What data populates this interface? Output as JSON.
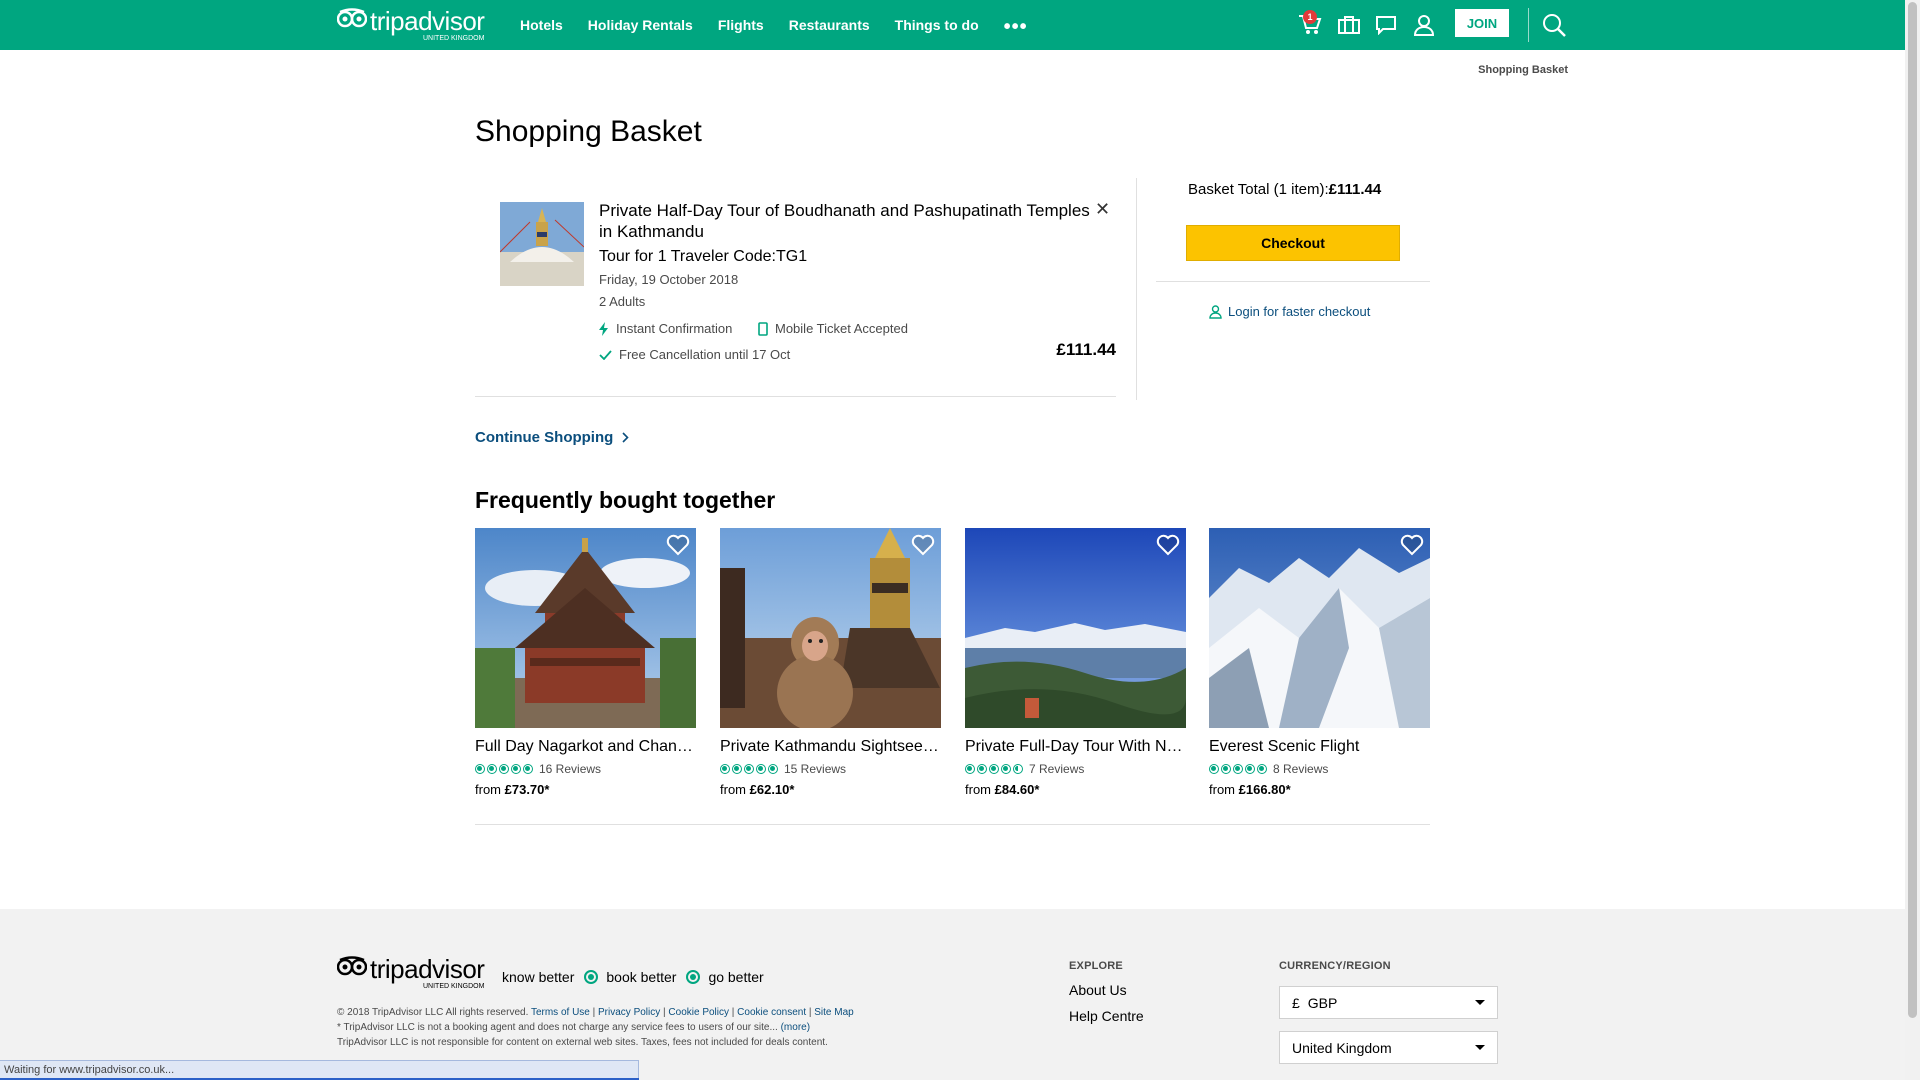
{
  "header": {
    "logo": {
      "word": "tripadvisor",
      "sub": "UNITED KINGDOM"
    },
    "nav": [
      "Hotels",
      "Holiday Rentals",
      "Flights",
      "Restaurants",
      "Things to do"
    ],
    "more": "•••",
    "icons": [
      "cart-icon",
      "trips-icon",
      "messages-icon",
      "profile-icon",
      "search-icon"
    ],
    "cart_count": "1",
    "join_label": "JOIN"
  },
  "breadcrumb": "Shopping Basket",
  "page_title": "Shopping Basket",
  "basket_item": {
    "title": "Private Half-Day Tour of Boudhanath and Pashupatinath Temples in Kathmandu",
    "subtitle": "Tour for 1 Traveler Code:TG1",
    "date": "Friday, 19 October 2018",
    "travelers": "2 Adults",
    "features": {
      "instant": "Instant Confirmation",
      "mobile": "Mobile Ticket Accepted",
      "cancellation": "Free Cancellation until 17 Oct"
    },
    "price": "£111.44",
    "remove": "✕"
  },
  "summary": {
    "total_label": "Basket Total (1 item):",
    "total_value": "£111.44",
    "checkout_label": "Checkout",
    "login_label": "Login for faster checkout"
  },
  "continue_label": "Continue Shopping",
  "fbt": {
    "title": "Frequently bought together",
    "cards": [
      {
        "title": "Full Day Nagarkot and Changu Narayan Tour",
        "rating": 5,
        "reviews": "16 Reviews",
        "from": "from ",
        "price": "£73.70*"
      },
      {
        "title": "Private Kathmandu Sightseeing Tour",
        "rating": 5,
        "reviews": "15 Reviews",
        "from": "from ",
        "price": "£62.10*"
      },
      {
        "title": "Private Full-Day Tour With Nagarkot Sunrise",
        "rating": 4.5,
        "reviews": "7 Reviews",
        "from": "from ",
        "price": "£84.60*"
      },
      {
        "title": "Everest Scenic Flight",
        "rating": 5,
        "reviews": "8 Reviews",
        "from": "from ",
        "price": "£166.80*"
      }
    ]
  },
  "footer": {
    "tagline": [
      "know better",
      "book better",
      "go better"
    ],
    "legal": {
      "copyright": "© 2018 TripAdvisor LLC All rights reserved.",
      "links": [
        "Terms of Use",
        "Privacy Policy",
        "Cookie Policy",
        "Cookie consent",
        "Site Map"
      ],
      "line2": "* TripAdvisor LLC is not a booking agent and does not charge any service fees to users of our site...",
      "more": "(more)",
      "line3": "TripAdvisor LLC is not responsible for content on external web sites. Taxes, fees not included for deals content."
    },
    "explore": {
      "heading": "EXPLORE",
      "links": [
        "About Us",
        "Help Centre"
      ]
    },
    "region": {
      "heading": "CURRENCY/REGION",
      "currency_symbol": "£",
      "currency": "GBP",
      "country": "United Kingdom"
    }
  },
  "status_bar": "Waiting for www.tripadvisor.co.uk...",
  "colors": {
    "brand": "#00a680",
    "checkout": "#fcc300",
    "link": "#0b4e7d"
  }
}
